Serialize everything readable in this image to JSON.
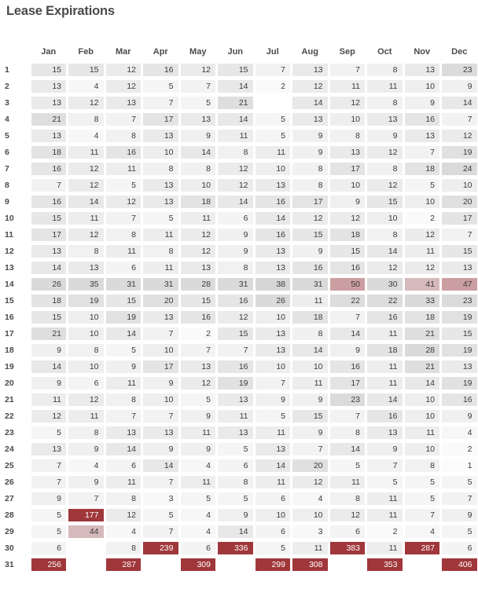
{
  "panel": {
    "title": "Lease Expirations"
  },
  "colors": {
    "title": "#4a4a4a",
    "text": "#3b3b3b",
    "background": "#ffffff",
    "heat_low": "#fafafa",
    "heat_high": "#d9d9d9",
    "accent_red": "#a0373b",
    "accent_red_light": "#c9a9ac"
  },
  "chart_data": {
    "type": "heatmap",
    "title": "Lease Expirations",
    "xlabel": "",
    "ylabel": "",
    "legend": "none",
    "grid": false,
    "row_header_label": "",
    "categories": [
      "Jan",
      "Feb",
      "Mar",
      "Apr",
      "May",
      "Jun",
      "Jul",
      "Aug",
      "Sep",
      "Oct",
      "Nov",
      "Dec"
    ],
    "rows": [
      "1",
      "2",
      "3",
      "4",
      "5",
      "6",
      "7",
      "8",
      "9",
      "10",
      "11",
      "12",
      "13",
      "14",
      "15",
      "16",
      "17",
      "18",
      "19",
      "20",
      "21",
      "22",
      "23",
      "24",
      "25",
      "26",
      "27",
      "28",
      "29",
      "30",
      "31"
    ],
    "values": [
      [
        15,
        15,
        12,
        16,
        12,
        15,
        7,
        13,
        7,
        8,
        13,
        23
      ],
      [
        13,
        4,
        12,
        5,
        7,
        14,
        2,
        12,
        11,
        11,
        10,
        9
      ],
      [
        13,
        12,
        13,
        7,
        5,
        21,
        null,
        14,
        12,
        8,
        9,
        14
      ],
      [
        21,
        8,
        7,
        17,
        13,
        14,
        5,
        13,
        10,
        13,
        16,
        7
      ],
      [
        13,
        4,
        8,
        13,
        9,
        11,
        5,
        9,
        8,
        9,
        13,
        12
      ],
      [
        18,
        11,
        16,
        10,
        14,
        8,
        11,
        9,
        13,
        12,
        7,
        19
      ],
      [
        16,
        12,
        11,
        8,
        8,
        12,
        10,
        8,
        17,
        8,
        18,
        24
      ],
      [
        7,
        12,
        5,
        13,
        10,
        12,
        13,
        8,
        10,
        12,
        5,
        10
      ],
      [
        16,
        14,
        12,
        13,
        18,
        14,
        16,
        17,
        9,
        15,
        10,
        20
      ],
      [
        15,
        11,
        7,
        5,
        11,
        6,
        14,
        12,
        12,
        10,
        2,
        17
      ],
      [
        17,
        12,
        8,
        11,
        12,
        9,
        16,
        15,
        18,
        8,
        12,
        7
      ],
      [
        13,
        8,
        11,
        8,
        12,
        9,
        13,
        9,
        15,
        14,
        11,
        15
      ],
      [
        14,
        13,
        6,
        11,
        13,
        8,
        13,
        16,
        16,
        12,
        12,
        13
      ],
      [
        26,
        35,
        31,
        31,
        28,
        31,
        38,
        31,
        50,
        30,
        41,
        47
      ],
      [
        18,
        19,
        15,
        20,
        15,
        16,
        26,
        11,
        22,
        22,
        33,
        23
      ],
      [
        15,
        10,
        19,
        13,
        16,
        12,
        10,
        18,
        7,
        16,
        18,
        19
      ],
      [
        21,
        10,
        14,
        7,
        2,
        15,
        13,
        8,
        14,
        11,
        21,
        15
      ],
      [
        9,
        8,
        5,
        10,
        7,
        7,
        13,
        14,
        9,
        18,
        28,
        19
      ],
      [
        14,
        10,
        9,
        17,
        13,
        16,
        10,
        10,
        16,
        11,
        21,
        13
      ],
      [
        9,
        6,
        11,
        9,
        12,
        19,
        7,
        11,
        17,
        11,
        14,
        19
      ],
      [
        11,
        12,
        8,
        10,
        5,
        13,
        9,
        9,
        23,
        14,
        10,
        16
      ],
      [
        12,
        11,
        7,
        7,
        9,
        11,
        5,
        15,
        7,
        16,
        10,
        9
      ],
      [
        5,
        8,
        13,
        13,
        11,
        13,
        11,
        9,
        8,
        13,
        11,
        4
      ],
      [
        13,
        9,
        14,
        9,
        9,
        5,
        13,
        7,
        14,
        9,
        10,
        2
      ],
      [
        7,
        4,
        6,
        14,
        4,
        6,
        14,
        20,
        5,
        7,
        8,
        1
      ],
      [
        7,
        9,
        11,
        7,
        11,
        8,
        11,
        12,
        11,
        5,
        5,
        5
      ],
      [
        9,
        7,
        8,
        3,
        5,
        5,
        6,
        4,
        8,
        11,
        5,
        7
      ],
      [
        5,
        177,
        12,
        5,
        4,
        9,
        10,
        10,
        12,
        11,
        7,
        9
      ],
      [
        5,
        44,
        4,
        7,
        4,
        14,
        6,
        3,
        6,
        2,
        4,
        5
      ],
      [
        6,
        null,
        8,
        239,
        6,
        336,
        5,
        11,
        383,
        11,
        287,
        6
      ],
      [
        256,
        null,
        287,
        null,
        309,
        null,
        299,
        308,
        null,
        353,
        null,
        406
      ]
    ],
    "value_min": 1,
    "value_max": 406,
    "colorscale_note": "grey tint scaled by value; high values rendered in red"
  }
}
